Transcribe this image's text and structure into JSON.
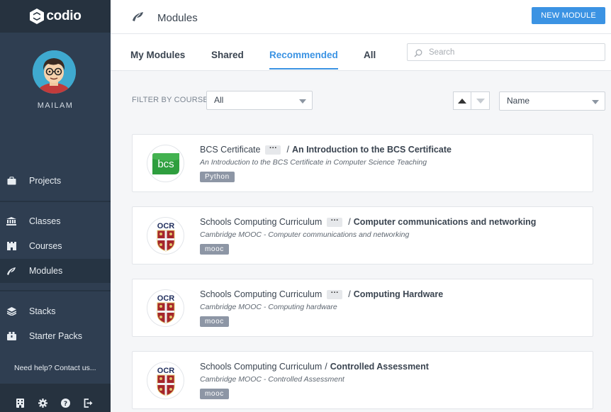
{
  "app": {
    "logo_text": "codio"
  },
  "user": {
    "name": "MAILAM"
  },
  "sidebar": {
    "items": [
      {
        "label": "Projects",
        "icon": "briefcase-icon"
      },
      {
        "label": "Classes",
        "icon": "institution-icon"
      },
      {
        "label": "Courses",
        "icon": "castle-icon"
      },
      {
        "label": "Modules",
        "icon": "module-icon",
        "active": true
      },
      {
        "label": "Stacks",
        "icon": "stack-icon"
      },
      {
        "label": "Starter Packs",
        "icon": "starter-pack-icon"
      }
    ],
    "help_text": "Need help? Contact us...",
    "bottom_icons": [
      "building-icon",
      "gear-icon",
      "help-icon",
      "logout-icon"
    ]
  },
  "header": {
    "title": "Modules",
    "new_button": "NEW MODULE"
  },
  "tabs": [
    {
      "label": "My Modules"
    },
    {
      "label": "Shared"
    },
    {
      "label": "Recommended",
      "active": true
    },
    {
      "label": "All"
    }
  ],
  "search": {
    "placeholder": "Search",
    "value": ""
  },
  "filter": {
    "label": "FILTER BY COURSE",
    "course_value": "All",
    "sort_value": "Name"
  },
  "modules": [
    {
      "course": "BCS Certificate",
      "has_more": true,
      "title": "An Introduction to the BCS Certificate",
      "subtitle": "An Introduction to the BCS Certificate in Computer Science Teaching",
      "tag": "Python",
      "logo": "bcs-logo"
    },
    {
      "course": "Schools Computing Curriculum",
      "has_more": true,
      "title": "Computer communications and networking",
      "subtitle": "Cambridge MOOC - Computer communications and networking",
      "tag": "mooc",
      "logo": "ocr-logo"
    },
    {
      "course": "Schools Computing Curriculum",
      "has_more": true,
      "title": "Computing Hardware",
      "subtitle": "Cambridge MOOC - Computing hardware",
      "tag": "mooc",
      "logo": "ocr-logo"
    },
    {
      "course": "Schools Computing Curriculum",
      "has_more": false,
      "title": "Controlled Assessment",
      "subtitle": "Cambridge MOOC - Controlled Assessment",
      "tag": "mooc",
      "logo": "ocr-logo"
    }
  ],
  "colors": {
    "sidebar": "#2f3e51",
    "sidebar_dark": "#26323f",
    "accent": "#3b93e3",
    "tag": "#8d96a5",
    "bcs_green": "#2e9e3e",
    "ocr_red": "#a5252b"
  }
}
